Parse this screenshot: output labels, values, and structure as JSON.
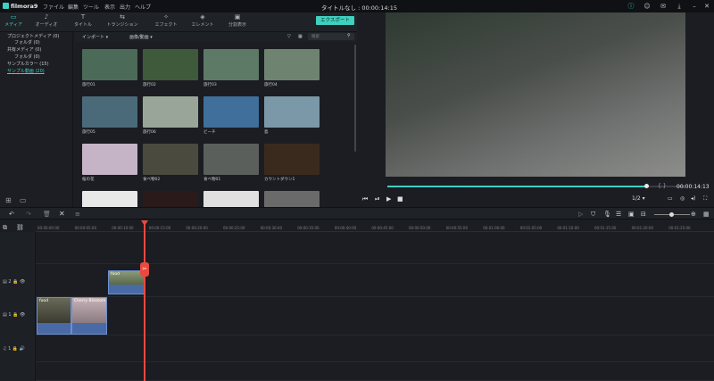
{
  "app": {
    "name": "filmora9",
    "window_title": "タイトルなし : 00:00:14:15"
  },
  "menu": [
    "ファイル",
    "編集",
    "ツール",
    "表示",
    "出力",
    "ヘルプ"
  ],
  "toolbar": {
    "tools": [
      "メディア",
      "オーディオ",
      "タイトル",
      "トランジション",
      "エフェクト",
      "エレメント",
      "分割表示"
    ],
    "export_label": "エクスポート"
  },
  "tree": [
    {
      "label": "プロジェクトメディア (0)",
      "selected": false
    },
    {
      "label": "フォルダ (0)",
      "selected": false
    },
    {
      "label": "共有メディア (0)",
      "selected": false
    },
    {
      "label": "フォルダ (0)",
      "selected": false
    },
    {
      "label": "サンプルカラー (15)",
      "selected": false
    },
    {
      "label": "サンプル動画 (20)",
      "selected": true
    }
  ],
  "library": {
    "import_label": "インポート",
    "view_label": "画像/動画",
    "search_placeholder": "検索"
  },
  "thumbnails": [
    {
      "label": "旅行01",
      "color": "#4b6a58"
    },
    {
      "label": "旅行02",
      "color": "#3f5a3a"
    },
    {
      "label": "旅行03",
      "color": "#5d7a66"
    },
    {
      "label": "旅行04",
      "color": "#6e8470"
    },
    {
      "label": "旅行05",
      "color": "#4a6a7a"
    },
    {
      "label": "旅行06",
      "color": "#9aa59a"
    },
    {
      "label": "ビーチ",
      "color": "#3f6f9a"
    },
    {
      "label": "島",
      "color": "#7a98a8"
    },
    {
      "label": "桜の花",
      "color": "#c5b4c6"
    },
    {
      "label": "食べ物02",
      "color": "#4a4a3e"
    },
    {
      "label": "食べ物01",
      "color": "#5b5f5c"
    },
    {
      "label": "カウントダウン1",
      "color": "#3a2a1e"
    },
    {
      "label": "",
      "color": "#e8e8e8"
    },
    {
      "label": "",
      "color": "#2a1a1a"
    },
    {
      "label": "",
      "color": "#e0e0e0"
    },
    {
      "label": "",
      "color": "#6a6a6a"
    }
  ],
  "player": {
    "current_time": "00:00:14:13",
    "progress": 0.85,
    "quality": "1/2"
  },
  "ruler": [
    "00:00:00:00",
    "00:00:05:00",
    "00:00:10:00",
    "00:00:15:00",
    "00:00:20:00",
    "00:00:25:00",
    "00:00:30:00",
    "00:00:35:00",
    "00:00:40:00",
    "00:00:45:00",
    "00:00:50:00",
    "00:00:55:00",
    "00:01:00:00",
    "00:01:05:00",
    "00:01:10:00",
    "00:01:15:00",
    "00:01:20:00",
    "00:01:25:00"
  ],
  "tracks": [
    {
      "label": "2"
    },
    {
      "label": "1"
    },
    {
      "label": "1"
    }
  ],
  "clips": {
    "v2": "food",
    "v1a": "food",
    "v1b": "Cherry Blossom"
  }
}
